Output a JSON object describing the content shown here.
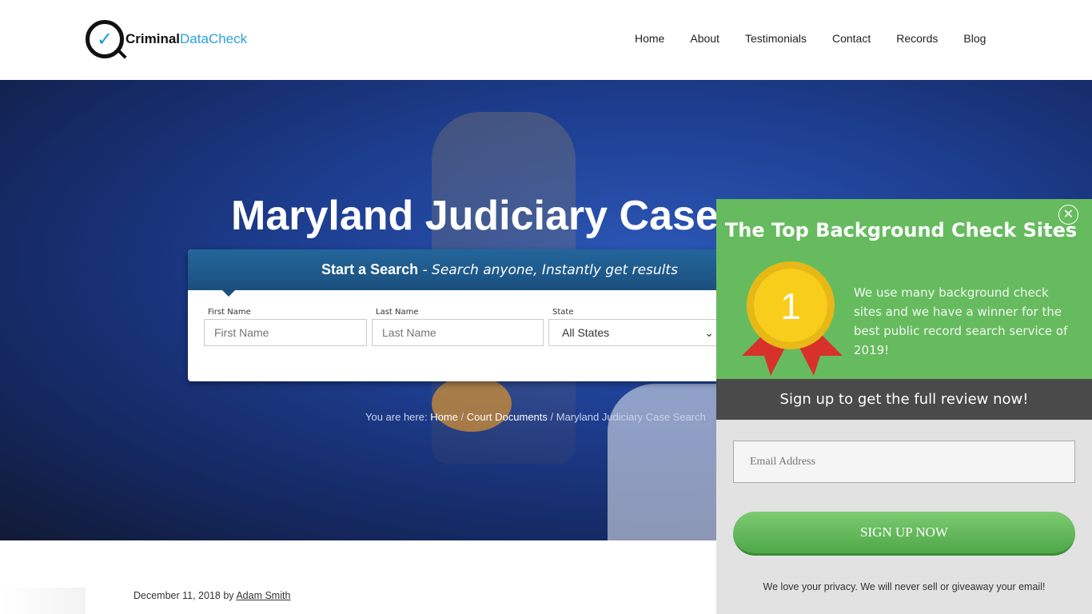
{
  "header": {
    "logo": {
      "part1": "Criminal",
      "part2": "DataCheck"
    },
    "nav": [
      "Home",
      "About",
      "Testimonials",
      "Contact",
      "Records",
      "Blog"
    ]
  },
  "hero": {
    "title": "Maryland Judiciary Case Search",
    "search": {
      "title": "Start a Search",
      "subtitle": " - Search anyone, Instantly get results",
      "first_label": "First Name",
      "first_placeholder": "First Name",
      "last_label": "Last Name",
      "last_placeholder": "Last Name",
      "state_label": "State",
      "state_value": "All States"
    },
    "breadcrumb": {
      "prefix": "You are here: ",
      "home": "Home",
      "sep": " / ",
      "section": "Court Documents",
      "current": "Maryland Judiciary Case Search"
    }
  },
  "post": {
    "date": "December 11, 2018",
    "by": " by ",
    "author": "Adam Smith"
  },
  "popup": {
    "title": "The Top Background Check Sites",
    "medal_number": "1",
    "text": "We use many background check sites and we have a winner for the best public record search service of 2019!",
    "bar": "Sign up to get the full review now!",
    "email_placeholder": "Email Address",
    "button": "SIGN UP NOW",
    "privacy": "We love your privacy.  We will never sell or giveaway your email!",
    "colors": {
      "green": "#66bb5f",
      "dark": "#4a4a4a",
      "gold": "#f8cd1c",
      "ribbon": "#d8302b"
    }
  }
}
